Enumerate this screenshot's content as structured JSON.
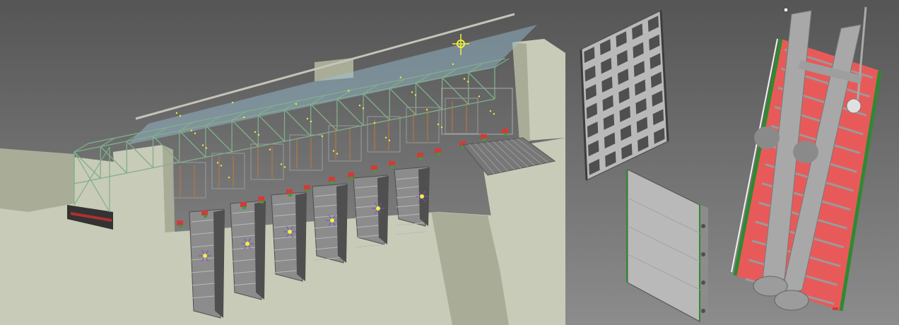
{
  "scene": {
    "background_top": "#555555",
    "background_bottom": "#8c8c8c",
    "concrete": "#c8cbb7",
    "concrete_shade": "#a9ad98",
    "concrete_dark": "#8f9380",
    "steel": "#8c8c8c",
    "steel_light": "#b9b9b9",
    "steel_dark": "#4f4f4f",
    "truss_green": "#7fb08a",
    "glass": "#9cc3d6",
    "motor_red": "#d23a3a",
    "motor_green": "#3e9a3e",
    "seal_red": "#e85a5a",
    "seal_green": "#2f8a2f",
    "marker_yellow": "#f0f040",
    "marker_purple": "#7a50c0"
  },
  "views": [
    {
      "name": "dam-spillway-assembly",
      "icon": "dam-3d-model-icon"
    },
    {
      "name": "lattice-gate-panel",
      "icon": "grid-gate-icon"
    },
    {
      "name": "plain-gate-panel",
      "icon": "flat-gate-icon"
    },
    {
      "name": "tilted-gate-frame",
      "icon": "gate-frame-icon"
    }
  ],
  "counts": {
    "spillway_bays": 6,
    "lattice_rows": 7,
    "lattice_cols": 5,
    "frame_rungs": 12
  }
}
